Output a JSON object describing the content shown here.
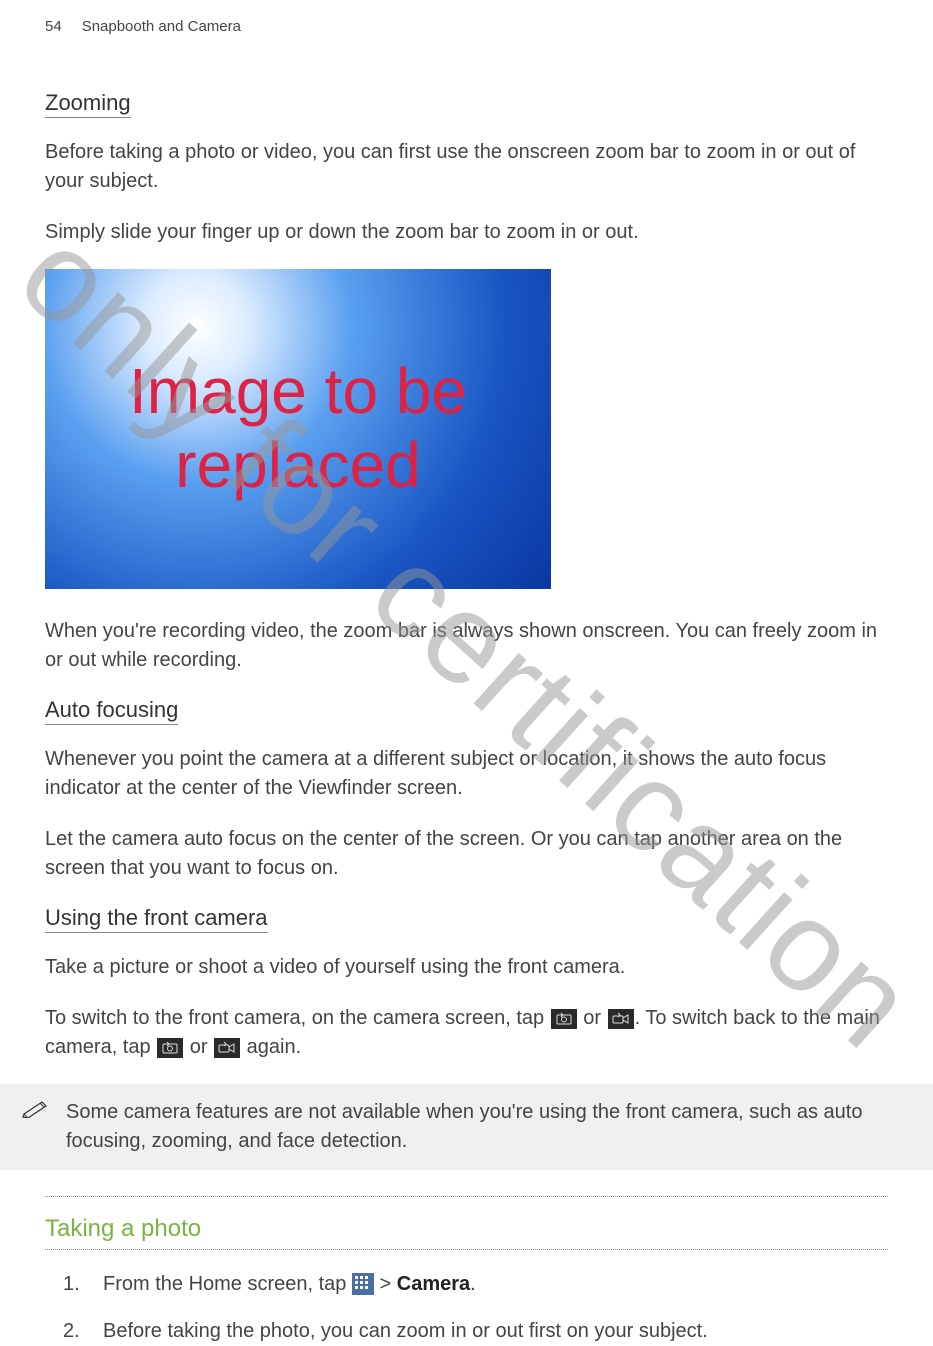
{
  "header": {
    "page_number": "54",
    "chapter_title": "Snapbooth and Camera"
  },
  "sections": {
    "zooming": {
      "heading": "Zooming",
      "p1": "Before taking a photo or video, you can first use the onscreen zoom bar to zoom in or out of your subject.",
      "p2": "Simply slide your finger up or down the zoom bar to zoom in or out.",
      "image_overlay": "Image to be replaced",
      "p3": "When you're recording video, the zoom bar is always shown onscreen. You can freely zoom in or out while recording."
    },
    "autofocus": {
      "heading": "Auto focusing",
      "p1": "Whenever you point the camera at a different subject or location, it shows the auto focus indicator at the center of the Viewfinder screen.",
      "p2": "Let the camera auto focus on the center of the screen. Or you can tap another area on the screen that you want to focus on."
    },
    "frontcam": {
      "heading": "Using the front camera",
      "p1": "Take a picture or shoot a video of yourself using the front camera.",
      "p2a": "To switch to the front camera, on the camera screen, tap ",
      "p2b": " or ",
      "p2c": ". To switch back to the main camera, tap ",
      "p2d": " or ",
      "p2e": " again.",
      "note": "Some camera features are not available when you're using the front camera, such as auto focusing, zooming, and face detection."
    },
    "taking_photo": {
      "title": "Taking a photo",
      "step1a": "From the Home screen, tap ",
      "step1b": " > ",
      "step1c": "Camera",
      "step1d": ".",
      "step2": "Before taking the photo, you can zoom in or out first on your subject."
    }
  },
  "watermark": "only for certification"
}
